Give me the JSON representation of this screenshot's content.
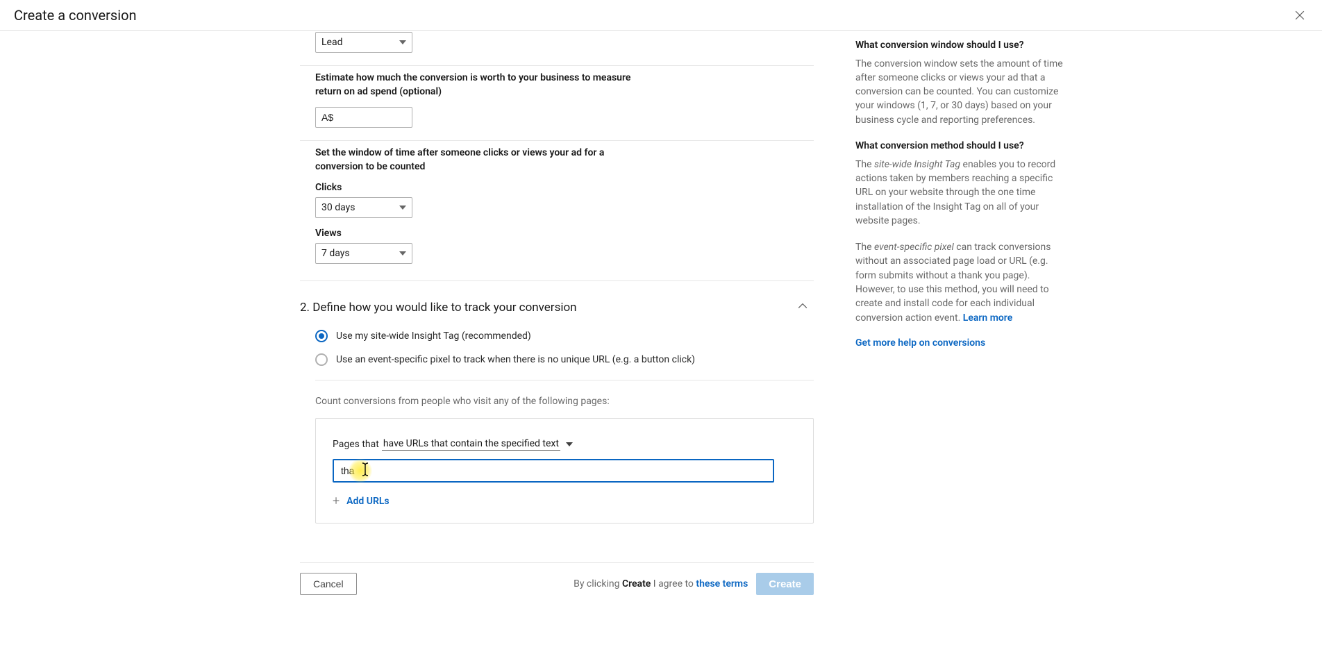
{
  "modal": {
    "title": "Create a conversion"
  },
  "form": {
    "lead_select": "Lead",
    "estimate_label": "Estimate how much the conversion is worth to your business to measure return on ad spend (optional)",
    "currency_prefix": "A$",
    "window_label": "Set the window of time after someone clicks or views your ad for a conversion to be counted",
    "clicks_label": "Clicks",
    "clicks_value": "30 days",
    "views_label": "Views",
    "views_value": "7 days"
  },
  "section2": {
    "heading": "2. Define how you would like to track your conversion",
    "radio1": "Use my site-wide Insight Tag (recommended)",
    "radio2": "Use an event-specific pixel to track when there is no unique URL (e.g. a button click)",
    "count_text": "Count conversions from people who visit any of the following pages:",
    "pages_prefix": "Pages that",
    "pages_option": "have URLs that contain the specified text",
    "url_value": "tha",
    "add_urls": "Add URLs"
  },
  "footer": {
    "cancel": "Cancel",
    "agree_prefix": "By clicking ",
    "agree_action": "Create",
    "agree_middle": " I agree to ",
    "agree_link": "these terms",
    "create": "Create"
  },
  "side": {
    "q1": "What conversion window should I use?",
    "p1": "The conversion window sets the amount of time after someone clicks or views your ad that a conversion can be counted. You can customize your windows (1, 7, or 30 days) based on your business cycle and reporting preferences.",
    "q2": "What conversion method should I use?",
    "p2a": "The ",
    "p2a_i": "site-wide Insight Tag",
    "p2a_end": " enables you to record actions taken by members reaching a specific URL on your website through the one time installation of the Insight Tag on all of your website pages.",
    "p2b": "The ",
    "p2b_i": "event-specific pixel",
    "p2b_end": " can track conversions without an associated page load or URL (e.g. form submits without a thank you page). However, to use this method, you will need to create and install code for each individual conversion action event. ",
    "learn_more": "Learn more",
    "help_link": "Get more help on conversions"
  }
}
